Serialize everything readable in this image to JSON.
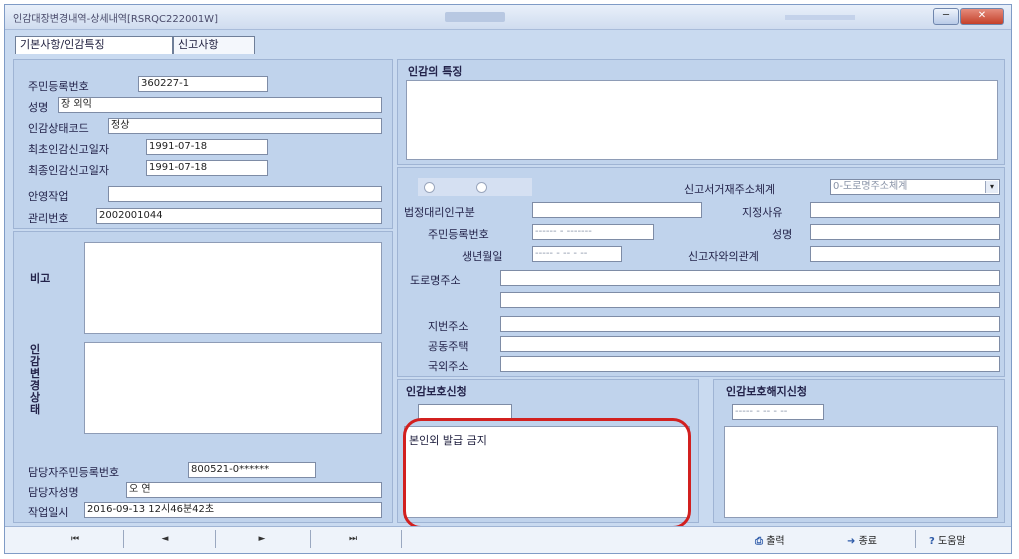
{
  "window": {
    "title": "인감대장변경내역-상세내역[RSRQC222001W]"
  },
  "tabs": [
    {
      "label": "기본사항/인감특징"
    },
    {
      "label": "신고사항"
    }
  ],
  "basic": {
    "rrn": {
      "label": "주민등록번호",
      "value": "360227-1"
    },
    "name": {
      "label": "성명",
      "value": "장 외익"
    },
    "status_code": {
      "label": "인감상태코드",
      "value": "정상"
    },
    "first_report_date": {
      "label": "최초인감신고일자",
      "value": "1991-07-18"
    },
    "last_report_date": {
      "label": "최종인감신고일자",
      "value": "1991-07-18"
    },
    "english_sign": {
      "label": "안영작업",
      "value": ""
    },
    "mgmt_no": {
      "label": "관리번호",
      "value": "2002001044"
    }
  },
  "notes": {
    "remark_label": "비고",
    "seal_change_label": "인감변경상태"
  },
  "officer": {
    "rrn": {
      "label": "담당자주민등록번호",
      "value": "800521-0******"
    },
    "name": {
      "label": "담당자성명",
      "value": "오  연"
    },
    "work_time": {
      "label": "작업일시",
      "value": "2016-09-13  12시46분42초"
    }
  },
  "features": {
    "header": "인감의 특징"
  },
  "report": {
    "radio1": "",
    "radio2": "",
    "addr_system": {
      "label": "신고서거재주소체계",
      "value": "0-도로명주소체계"
    },
    "legal_rep_type": {
      "label": "법정대리인구분",
      "value": ""
    },
    "designation_reason": {
      "label": "지정사유",
      "value": ""
    },
    "rrn": {
      "label": "주민등록번호",
      "value": "------ - -------"
    },
    "name": {
      "label": "성명",
      "value": ""
    },
    "birth": {
      "label": "생년월일",
      "value": "----- - -- - --"
    },
    "relation": {
      "label": "신고자와의관계",
      "value": ""
    },
    "road_address": {
      "label": "도로명주소",
      "value": ""
    },
    "road_address2": "",
    "lot_address": {
      "label": "지번주소",
      "value": ""
    },
    "apartment": {
      "label": "공동주택",
      "value": ""
    },
    "foreign_address": {
      "label": "국외주소",
      "value": ""
    }
  },
  "protection": {
    "header": "인감보호신청",
    "text": "본인외 발급 금지",
    "date": ""
  },
  "protection_cancel": {
    "header": "인감보호해지신청",
    "date": "----- - -- - --"
  },
  "navbar": {
    "first": "⏮",
    "prev": "◄",
    "next": "►",
    "last": "⏭",
    "print": "출력",
    "close": "종료",
    "help": "도움말"
  },
  "colors": {
    "highlight": "#d2201f",
    "panel": "#c0d3ec"
  }
}
